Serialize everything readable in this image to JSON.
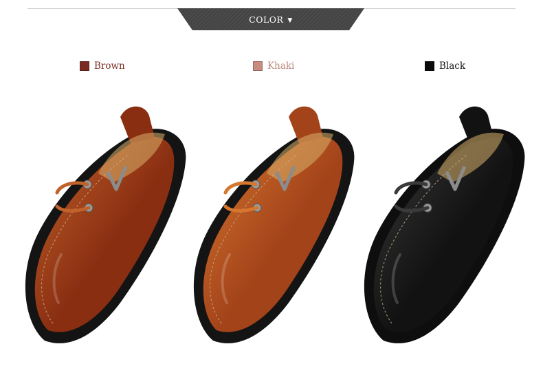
{
  "header": {
    "title": "COLOR",
    "arrow": "▼",
    "banner_color": "#4a4a4a"
  },
  "colors": [
    {
      "label": "Brown",
      "swatch": "#7a2a22",
      "text_color": "#7a2a22"
    },
    {
      "label": "Khaki",
      "swatch": "#c98b80",
      "text_color": "#b9897f"
    },
    {
      "label": "Black",
      "swatch": "#0b0b0b",
      "text_color": "#111111"
    }
  ],
  "shoes": [
    {
      "name": "brown-shoe",
      "upper": "#8a2e12",
      "highlight": "#c0622a",
      "sole": "#141414"
    },
    {
      "name": "khaki-shoe",
      "upper": "#a3431a",
      "highlight": "#d6772f",
      "sole": "#141414"
    },
    {
      "name": "black-shoe",
      "upper": "#121212",
      "highlight": "#3a3a3a",
      "sole": "#0e0e0e"
    }
  ]
}
